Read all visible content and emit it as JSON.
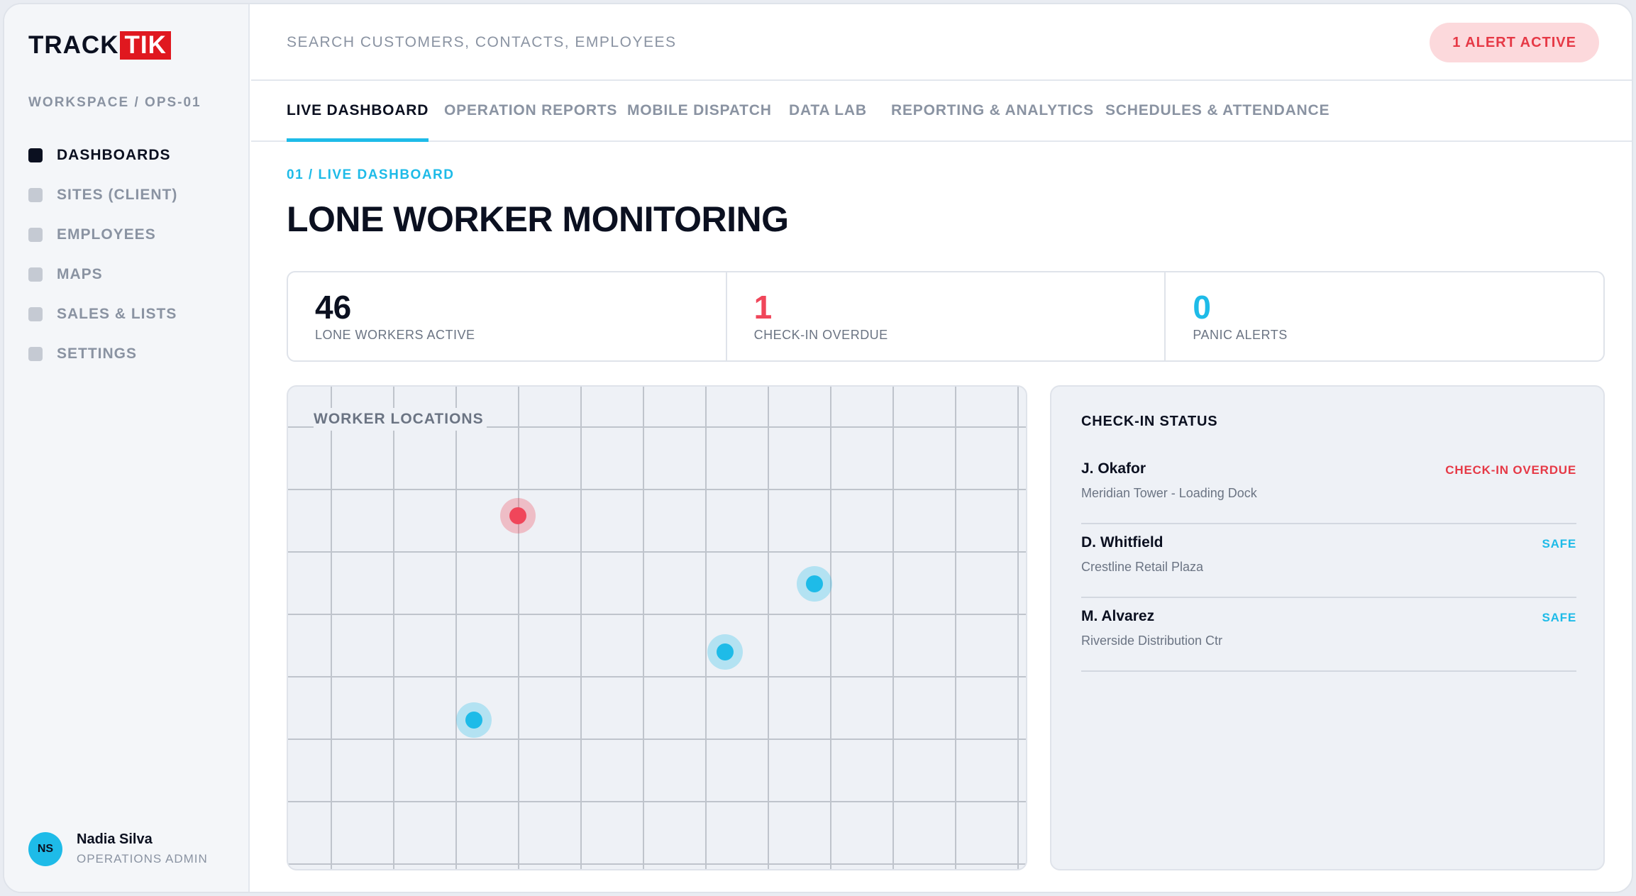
{
  "brand": {
    "part1": "TRACK",
    "part2": "TIK",
    "accent": "#e0181f"
  },
  "sidebar": {
    "workspace": "WORKSPACE / OPS-01",
    "items": [
      {
        "label": "DASHBOARDS",
        "active": true
      },
      {
        "label": "SITES (CLIENT)",
        "active": false
      },
      {
        "label": "EMPLOYEES",
        "active": false
      },
      {
        "label": "MAPS",
        "active": false
      },
      {
        "label": "SALES & LISTS",
        "active": false
      },
      {
        "label": "SETTINGS",
        "active": false
      }
    ],
    "user": {
      "initials": "NS",
      "name": "Nadia Silva",
      "role": "OPERATIONS ADMIN"
    }
  },
  "header": {
    "search_placeholder": "SEARCH CUSTOMERS, CONTACTS, EMPLOYEES",
    "alert": "1 ALERT ACTIVE"
  },
  "tabs": [
    {
      "label": "LIVE DASHBOARD",
      "active": true
    },
    {
      "label": "OPERATION REPORTS",
      "active": false
    },
    {
      "label": "MOBILE DISPATCH",
      "active": false
    },
    {
      "label": "DATA LAB",
      "active": false
    },
    {
      "label": "REPORTING & ANALYTICS",
      "active": false
    },
    {
      "label": "SCHEDULES & ATTENDANCE",
      "active": false
    }
  ],
  "page": {
    "breadcrumb": "01 / LIVE DASHBOARD",
    "title": "LONE WORKER MONITORING"
  },
  "stats": [
    {
      "value": "46",
      "label": "LONE WORKERS ACTIVE",
      "color": "#0b1020"
    },
    {
      "value": "1",
      "label": "CHECK-IN OVERDUE",
      "color": "#f0465a"
    },
    {
      "value": "0",
      "label": "PANIC ALERTS",
      "color": "#1ebbe8"
    }
  ],
  "map": {
    "title": "WORKER LOCATIONS",
    "pins": [
      {
        "status": "overdue"
      },
      {
        "status": "safe"
      },
      {
        "status": "safe"
      },
      {
        "status": "safe"
      }
    ]
  },
  "checkin": {
    "title": "CHECK-IN STATUS",
    "rows": [
      {
        "name": "J. Okafor",
        "site": "Meridian Tower - Loading Dock",
        "status": "CHECK-IN OVERDUE",
        "kind": "overdue"
      },
      {
        "name": "D. Whitfield",
        "site": "Crestline Retail Plaza",
        "status": "SAFE",
        "kind": "safe"
      },
      {
        "name": "M. Alvarez",
        "site": "Riverside Distribution Ctr",
        "status": "SAFE",
        "kind": "safe"
      }
    ]
  },
  "colors": {
    "accent": "#1ebbe8",
    "danger": "#f0465a",
    "ink": "#0b1020",
    "muted": "#8a93a2"
  }
}
